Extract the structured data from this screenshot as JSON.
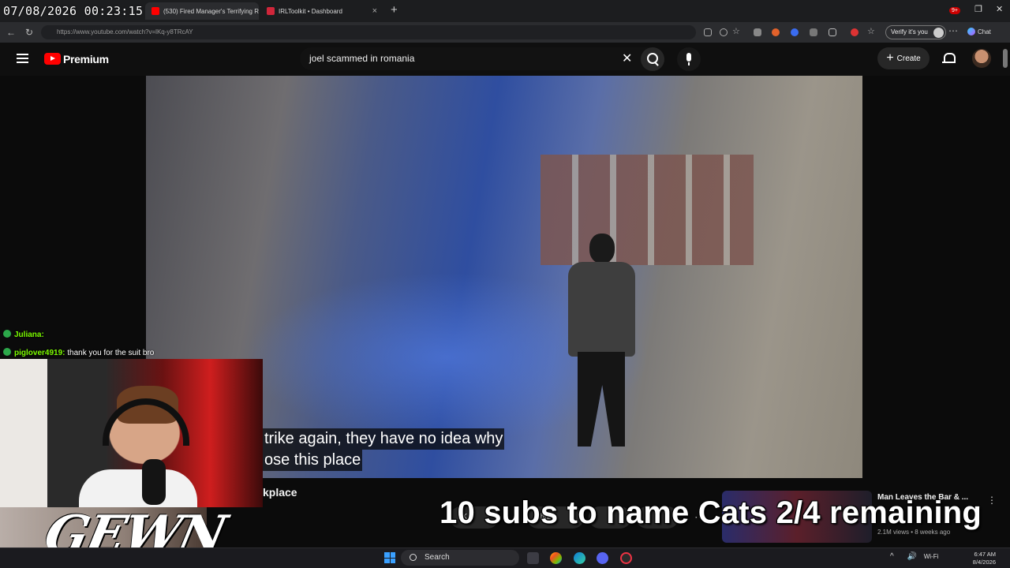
{
  "stream_timestamp": "07/08/2026 00:23:15",
  "browser": {
    "tabs": [
      {
        "label": "(530) Fired Manager's Terrifying Re",
        "active": true
      },
      {
        "label": "IRLToolkit • Dashboard",
        "active": false
      }
    ],
    "new_tab": "+",
    "url": "https://www.youtube.com/watch?v=lKq-y8TRcAY",
    "verify_label": "Verify it's you",
    "chat_label": "Chat",
    "window_controls": [
      "–",
      "❐",
      "✕"
    ]
  },
  "youtube": {
    "brand": "Premium",
    "search_query": "joel scammed in romania",
    "create_label": "Create",
    "notification_count": "9+",
    "subtitle_lines": [
      "trike again, they have no idea why",
      "ose this place"
    ],
    "video_title_fragment": "kplace",
    "action_pills": [
      "5K",
      "Share",
      "",
      ""
    ],
    "recommended": {
      "title": "Man Leaves the Bar & ...",
      "meta": "2.1M views • 8 weeks ago"
    }
  },
  "stream_chat": [
    {
      "user": "Juliana:",
      "message": ""
    },
    {
      "user": "piglover4919:",
      "message": "thank you for the suit bro"
    }
  ],
  "overlay": {
    "logo_text": "GEWN",
    "banner": "10 subs to name Cats 2/4 remaining"
  },
  "taskbar": {
    "search_label": "Search",
    "time": "6:47 AM",
    "date": "8/4/2026",
    "tray_icons": [
      "^",
      "🔊",
      "Wi-Fi"
    ]
  },
  "colors": {
    "youtube_red": "#ff0000",
    "chat_username": "#7CFC00",
    "notification_badge": "#cc0000"
  }
}
